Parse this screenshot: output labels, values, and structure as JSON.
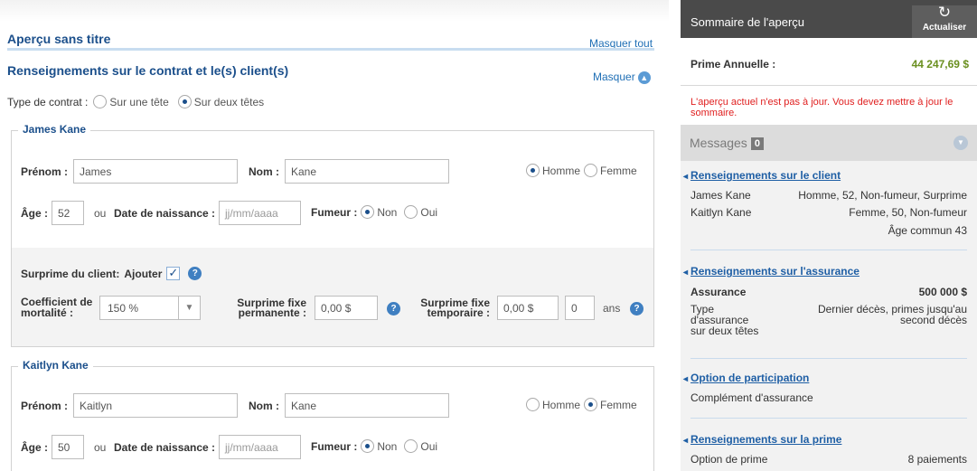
{
  "left": {
    "page_title": "Aperçu sans titre",
    "hide_all": "Masquer tout",
    "section_title": "Renseignements sur le contrat et le(s) client(s)",
    "hide": "Masquer",
    "contract_type": {
      "label": "Type de contrat :",
      "option_single": "Sur une tête",
      "option_joint": "Sur deux têtes",
      "selected": "Sur deux têtes"
    },
    "clients": [
      {
        "legend": "James Kane",
        "first_name_label": "Prénom :",
        "first_name": "James",
        "last_name_label": "Nom :",
        "last_name": "Kane",
        "male": "Homme",
        "female": "Femme",
        "sex_selected": "Homme",
        "age_label": "Âge :",
        "age": "52",
        "or": "ou",
        "dob_label": "Date de naissance :",
        "dob_placeholder": "jj/mm/aaaa",
        "smoker_label": "Fumeur :",
        "smoker_no": "Non",
        "smoker_yes": "Oui",
        "smoker_selected": "Non",
        "surcharge": {
          "label": "Surprime du client:",
          "add_label": "Ajouter",
          "add_checked": true,
          "mortality_label_1": "Coefficient de",
          "mortality_label_2": "mortalité :",
          "mortality_value": "150 %",
          "perm_label_1": "Surprime fixe",
          "perm_label_2": "permanente :",
          "perm_value": "0,00 $",
          "temp_label_1": "Surprime fixe",
          "temp_label_2": "temporaire :",
          "temp_value": "0,00 $",
          "years_value": "0",
          "years_label": "ans"
        }
      },
      {
        "legend": "Kaitlyn Kane",
        "first_name_label": "Prénom :",
        "first_name": "Kaitlyn",
        "last_name_label": "Nom :",
        "last_name": "Kane",
        "male": "Homme",
        "female": "Femme",
        "sex_selected": "Femme",
        "age_label": "Âge :",
        "age": "50",
        "or": "ou",
        "dob_label": "Date de naissance :",
        "dob_placeholder": "jj/mm/aaaa",
        "smoker_label": "Fumeur :",
        "smoker_no": "Non",
        "smoker_yes": "Oui",
        "smoker_selected": "Non"
      }
    ]
  },
  "summary": {
    "title": "Sommaire de l'aperçu",
    "refresh_icon": "refresh-icon",
    "refresh_label": "Actualiser",
    "annual_premium_label": "Prime Annuelle :",
    "annual_premium_value": "44 247,69 $",
    "warning": "L'aperçu actuel n'est pas à jour. Vous devez mettre à jour le sommaire.",
    "messages_label": "Messages",
    "messages_count": "0",
    "client_section": {
      "title": "Renseignements sur le client",
      "rows": [
        {
          "name": "James Kane",
          "detail": "Homme, 52, Non-fumeur, Surprime"
        },
        {
          "name": "Kaitlyn Kane",
          "detail": "Femme, 50, Non-fumeur"
        }
      ],
      "joint_age": "Âge commun 43"
    },
    "insurance_section": {
      "title": "Renseignements sur l'assurance",
      "amount_label": "Assurance",
      "amount_value": "500 000 $",
      "type_label_1": "Type",
      "type_label_2": "d'assurance",
      "type_label_3": "sur deux têtes",
      "type_value_1": "Dernier décès, primes jusqu'au",
      "type_value_2": "second décès"
    },
    "participation_section": {
      "title": "Option de participation",
      "value": "Complément d'assurance"
    },
    "premium_section": {
      "title": "Renseignements sur la prime",
      "option_label": "Option de prime",
      "option_value": "8 paiements"
    }
  },
  "colors": {
    "brand_blue": "#1b4f8b",
    "link_blue": "#1f6fb5",
    "premium_green": "#6a8f1f",
    "warning_red": "#e02020",
    "header_dark": "#4a4a4a"
  }
}
